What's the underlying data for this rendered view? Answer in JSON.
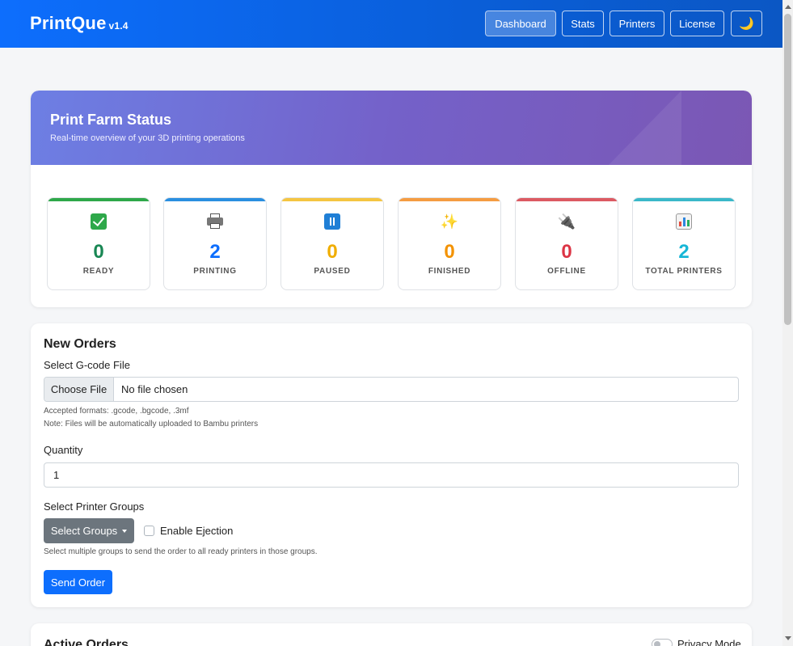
{
  "app": {
    "name": "PrintQue",
    "version": "v1.4"
  },
  "nav": {
    "items": [
      {
        "label": "Dashboard",
        "active": true
      },
      {
        "label": "Stats"
      },
      {
        "label": "Printers"
      },
      {
        "label": "License"
      }
    ],
    "theme_icon": "🌙"
  },
  "status": {
    "title": "Print Farm Status",
    "subtitle": "Real-time overview of your 3D printing operations",
    "stats": [
      {
        "label": "READY",
        "value": "0",
        "color": "#198754",
        "icon": "check-icon"
      },
      {
        "label": "PRINTING",
        "value": "2",
        "color": "#0d6efd",
        "icon": "printer-icon"
      },
      {
        "label": "PAUSED",
        "value": "0",
        "color": "#ffc107",
        "icon": "pause-icon"
      },
      {
        "label": "FINISHED",
        "value": "0",
        "color": "#fd7e14",
        "icon": "sparkles-icon",
        "glyph": "✨"
      },
      {
        "label": "OFFLINE",
        "value": "0",
        "color": "#dc3545",
        "icon": "plug-icon",
        "glyph": "🔌"
      },
      {
        "label": "TOTAL PRINTERS",
        "value": "2",
        "color": "#0dcaf0",
        "icon": "chart-icon"
      }
    ]
  },
  "orders": {
    "title": "New Orders",
    "file_label": "Select G-code File",
    "file_button": "Choose File",
    "file_value": "No file chosen",
    "formats_help": "Accepted formats: .gcode, .bgcode, .3mf",
    "note_help": "Note: Files will be automatically uploaded to Bambu printers",
    "quantity_label": "Quantity",
    "quantity_value": "1",
    "groups_label": "Select Printer Groups",
    "groups_button": "Select Groups",
    "ejection_label": "Enable Ejection",
    "groups_help": "Select multiple groups to send the order to all ready printers in those groups.",
    "send_button": "Send Order"
  },
  "active_orders": {
    "title": "Active Orders",
    "privacy_label": "Privacy Mode"
  }
}
